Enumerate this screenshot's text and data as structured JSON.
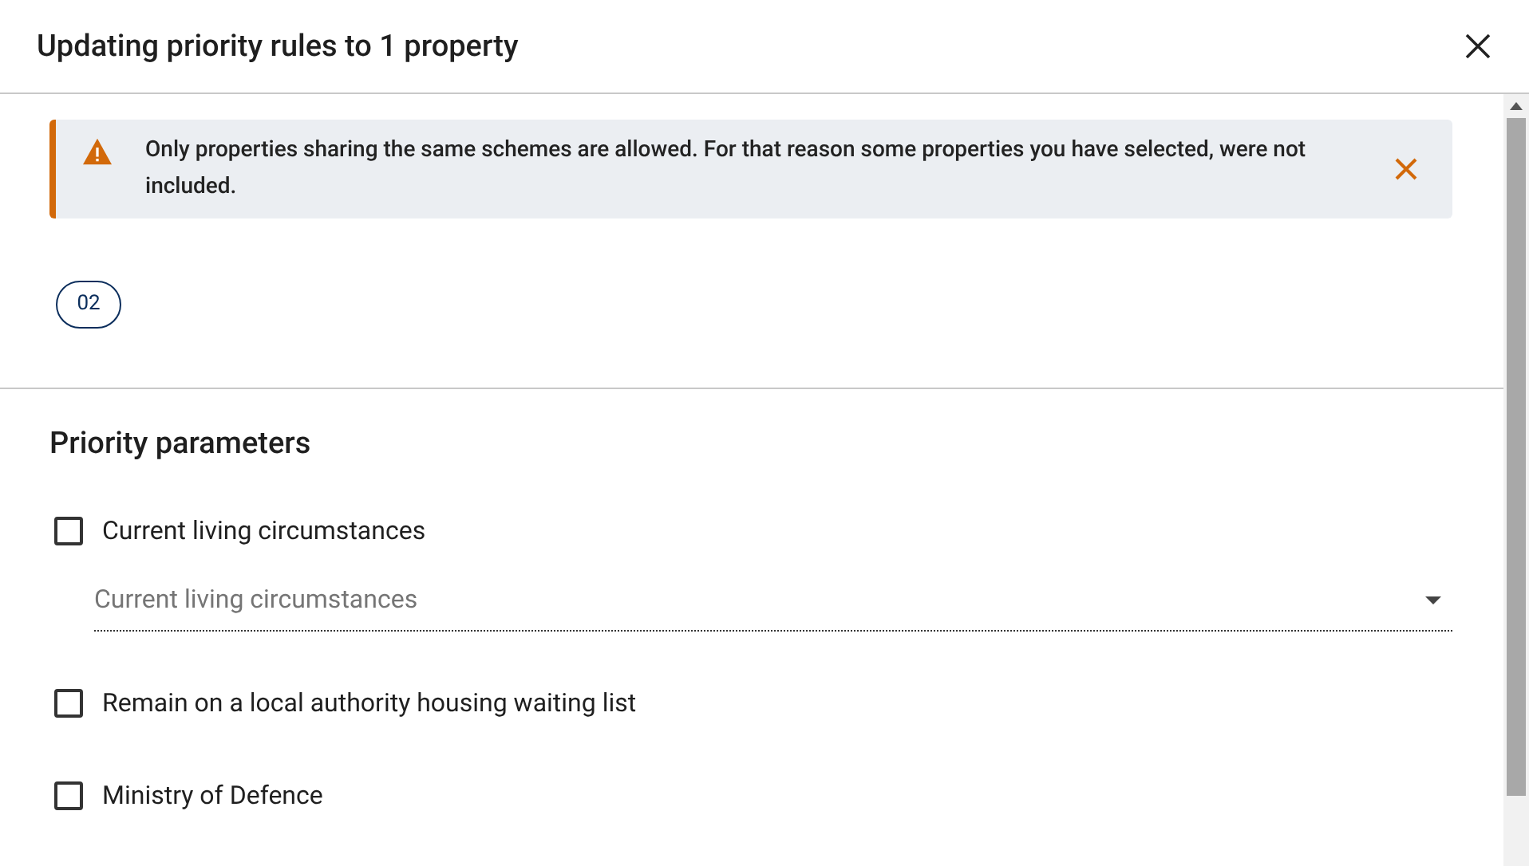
{
  "dialog": {
    "title": "Updating priority rules to 1 property"
  },
  "alert": {
    "message": "Only properties sharing the same schemes are allowed. For that reason some properties you have selected, were not included."
  },
  "chips": [
    {
      "label": "02"
    }
  ],
  "section": {
    "title": "Priority parameters"
  },
  "parameters": [
    {
      "kind": "checkbox",
      "label": "Current living circumstances",
      "checked": false
    },
    {
      "kind": "select",
      "placeholder": "Current living circumstances"
    },
    {
      "kind": "checkbox",
      "label": "Remain on a local authority housing waiting list",
      "checked": false
    },
    {
      "kind": "checkbox",
      "label": "Ministry of Defence",
      "checked": false
    }
  ]
}
